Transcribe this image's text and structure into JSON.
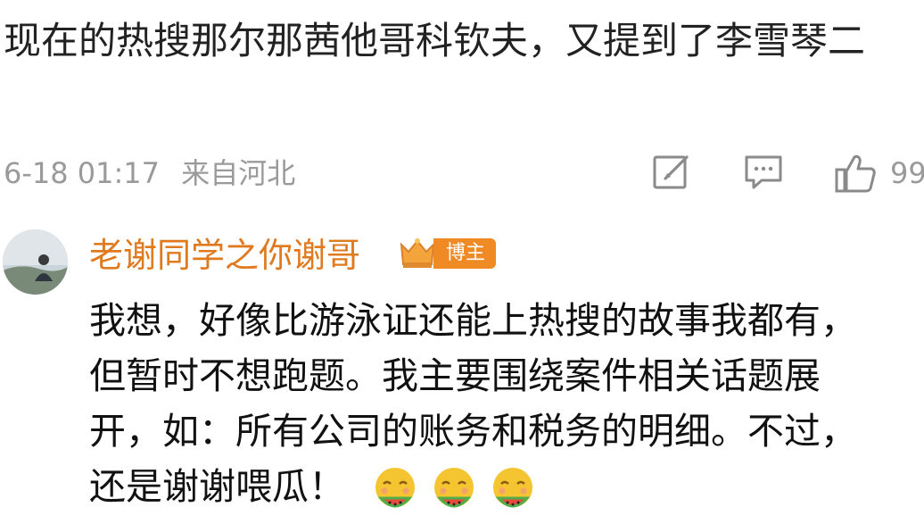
{
  "post": {
    "text": "现在的热搜那尔那茜他哥科钦夫，又提到了李雪琴二",
    "time": "6-18 01:17",
    "location": "来自河北",
    "like_count": "99"
  },
  "reply": {
    "username": "老谢同学之你谢哥",
    "badge_label": "博主",
    "lines": [
      "我想，好像比游泳证还能上热搜的故事我都有，",
      "但暂时不想跑题。我主要围绕案件相关话题展",
      "开，如：所有公司的账务和税务的明细。不过，",
      "还是谢谢喂瓜！"
    ],
    "emojis": [
      "eating-melon-emoji",
      "eating-melon-emoji",
      "eating-melon-emoji"
    ]
  },
  "icons": {
    "edit": "edit-icon",
    "comment": "comment-icon",
    "like": "thumbs-up-icon"
  },
  "colors": {
    "username": "#e07a1f",
    "badge": "#f08a24",
    "meta": "#9a9a9a",
    "emoji_face": "#f5c431",
    "emoji_melon": "#e84b3c"
  }
}
